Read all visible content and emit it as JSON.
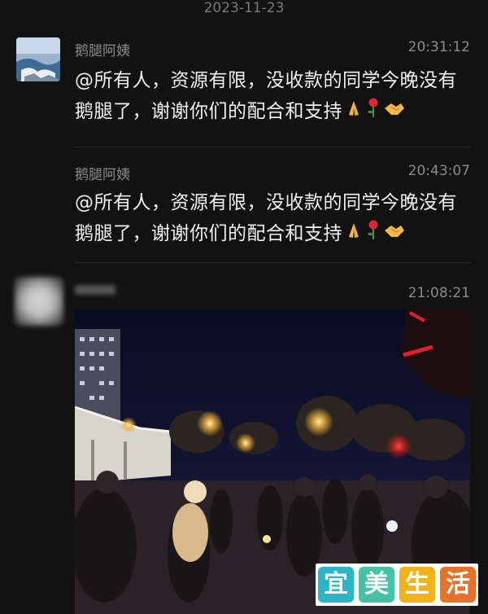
{
  "chat": {
    "date_separator": "2023-11-23",
    "messages": [
      {
        "sender": "鹅腿阿姨",
        "time": "20:31:12",
        "text": "@所有人，资源有限，没收款的同学今晚没有鹅腿了，谢谢你们的配合和支持",
        "emojis": [
          "folded-hands-icon",
          "rose-icon",
          "handshake-icon"
        ]
      },
      {
        "sender": "鹅腿阿姨",
        "time": "20:43:07",
        "text": "@所有人，资源有限，没收款的同学今晚没有鹅腿了，谢谢你们的配合和支持",
        "emojis": [
          "folded-hands-icon",
          "rose-icon",
          "handshake-icon"
        ]
      },
      {
        "sender": "",
        "time": "21:08:21",
        "image": "night street crowd photo"
      }
    ]
  },
  "watermark": {
    "chars": [
      "宜",
      "美",
      "生",
      "活"
    ],
    "colors": [
      "#2bb6c8",
      "#45c1a4",
      "#f1b31c",
      "#e8712a"
    ]
  }
}
